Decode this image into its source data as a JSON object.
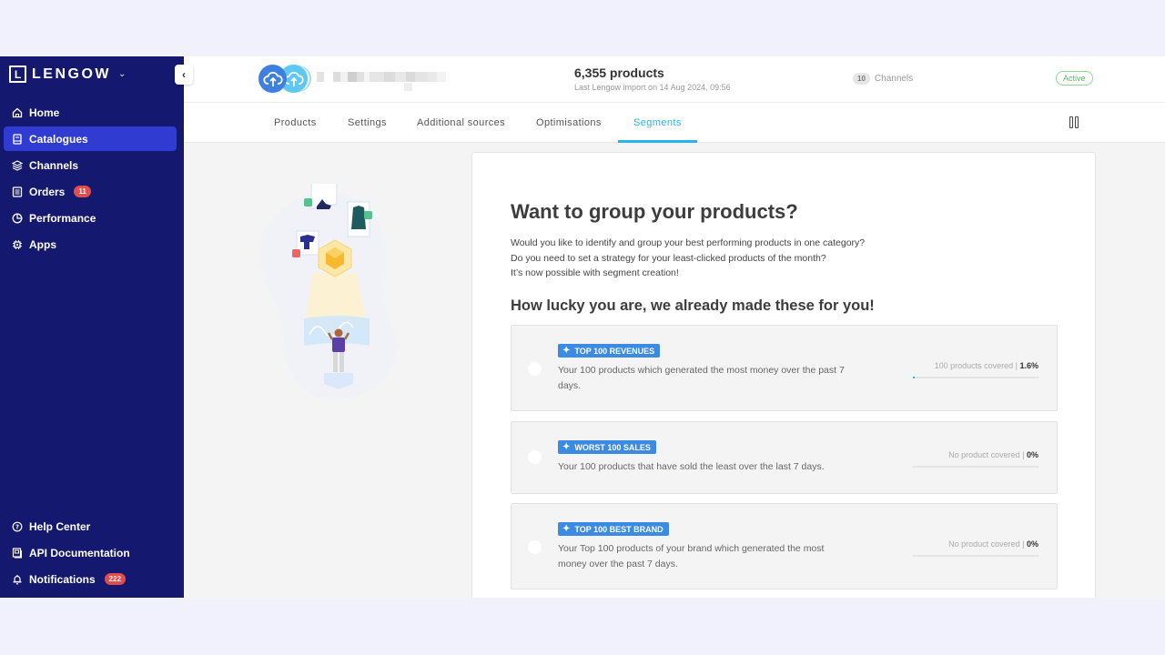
{
  "sidebar": {
    "brand": "LENGOW",
    "logo_letter": "L",
    "items": [
      {
        "label": "Home",
        "icon": "home-icon",
        "active": false
      },
      {
        "label": "Catalogues",
        "icon": "catalogue-icon",
        "active": true
      },
      {
        "label": "Channels",
        "icon": "layers-icon",
        "active": false
      },
      {
        "label": "Orders",
        "icon": "receipt-icon",
        "active": false,
        "badge": "11"
      },
      {
        "label": "Performance",
        "icon": "pie-chart-icon",
        "active": false
      },
      {
        "label": "Apps",
        "icon": "chip-icon",
        "active": false
      }
    ],
    "bottom_items": [
      {
        "label": "Help Center",
        "icon": "help-icon"
      },
      {
        "label": "API Documentation",
        "icon": "api-doc-icon"
      },
      {
        "label": "Notifications",
        "icon": "bell-icon",
        "badge": "222"
      }
    ]
  },
  "header": {
    "products_count": "6,355 products",
    "last_import": "Last Lengow import on 14 Aug 2024, 09:56",
    "channels_count": "10",
    "channels_label": "Channels",
    "status": "Active",
    "status_color": "#5cb866"
  },
  "tabs": [
    {
      "label": "Products",
      "active": false
    },
    {
      "label": "Settings",
      "active": false
    },
    {
      "label": "Additional sources",
      "active": false
    },
    {
      "label": "Optimisations",
      "active": false
    },
    {
      "label": "Segments",
      "active": true
    }
  ],
  "main": {
    "title": "Want to group your products?",
    "intro_lines": [
      "Would you like to identify and group your best performing products in one category?",
      "Do you need to set a strategy for your least-clicked products of the month?",
      "It’s now possible with segment creation!"
    ],
    "subtitle": "How lucky you are, we already made these for you!",
    "segments": [
      {
        "tag": "TOP 100 REVENUES",
        "desc": "Your 100 products which generated the most money over the past 7 days.",
        "coverage_label": "100 products covered | ",
        "coverage_pct": "1.6%",
        "coverage_value": 0.016
      },
      {
        "tag": "WORST 100 SALES",
        "desc": "Your 100 products that have sold the least over the last 7 days.",
        "coverage_label": "No product covered | ",
        "coverage_pct": "0%",
        "coverage_value": 0
      },
      {
        "tag": "TOP 100 BEST BRAND",
        "desc": "Your Top 100 products of your brand which generated the most money over the past 7 days.",
        "coverage_label": "No product covered | ",
        "coverage_pct": "0%",
        "coverage_value": 0
      }
    ]
  },
  "colors": {
    "sidebar_bg": "#15186f",
    "sidebar_active": "#2f3bd1",
    "accent": "#29b3ec",
    "tag_bg": "#3b8be3",
    "badge_red": "#e54b4b"
  }
}
